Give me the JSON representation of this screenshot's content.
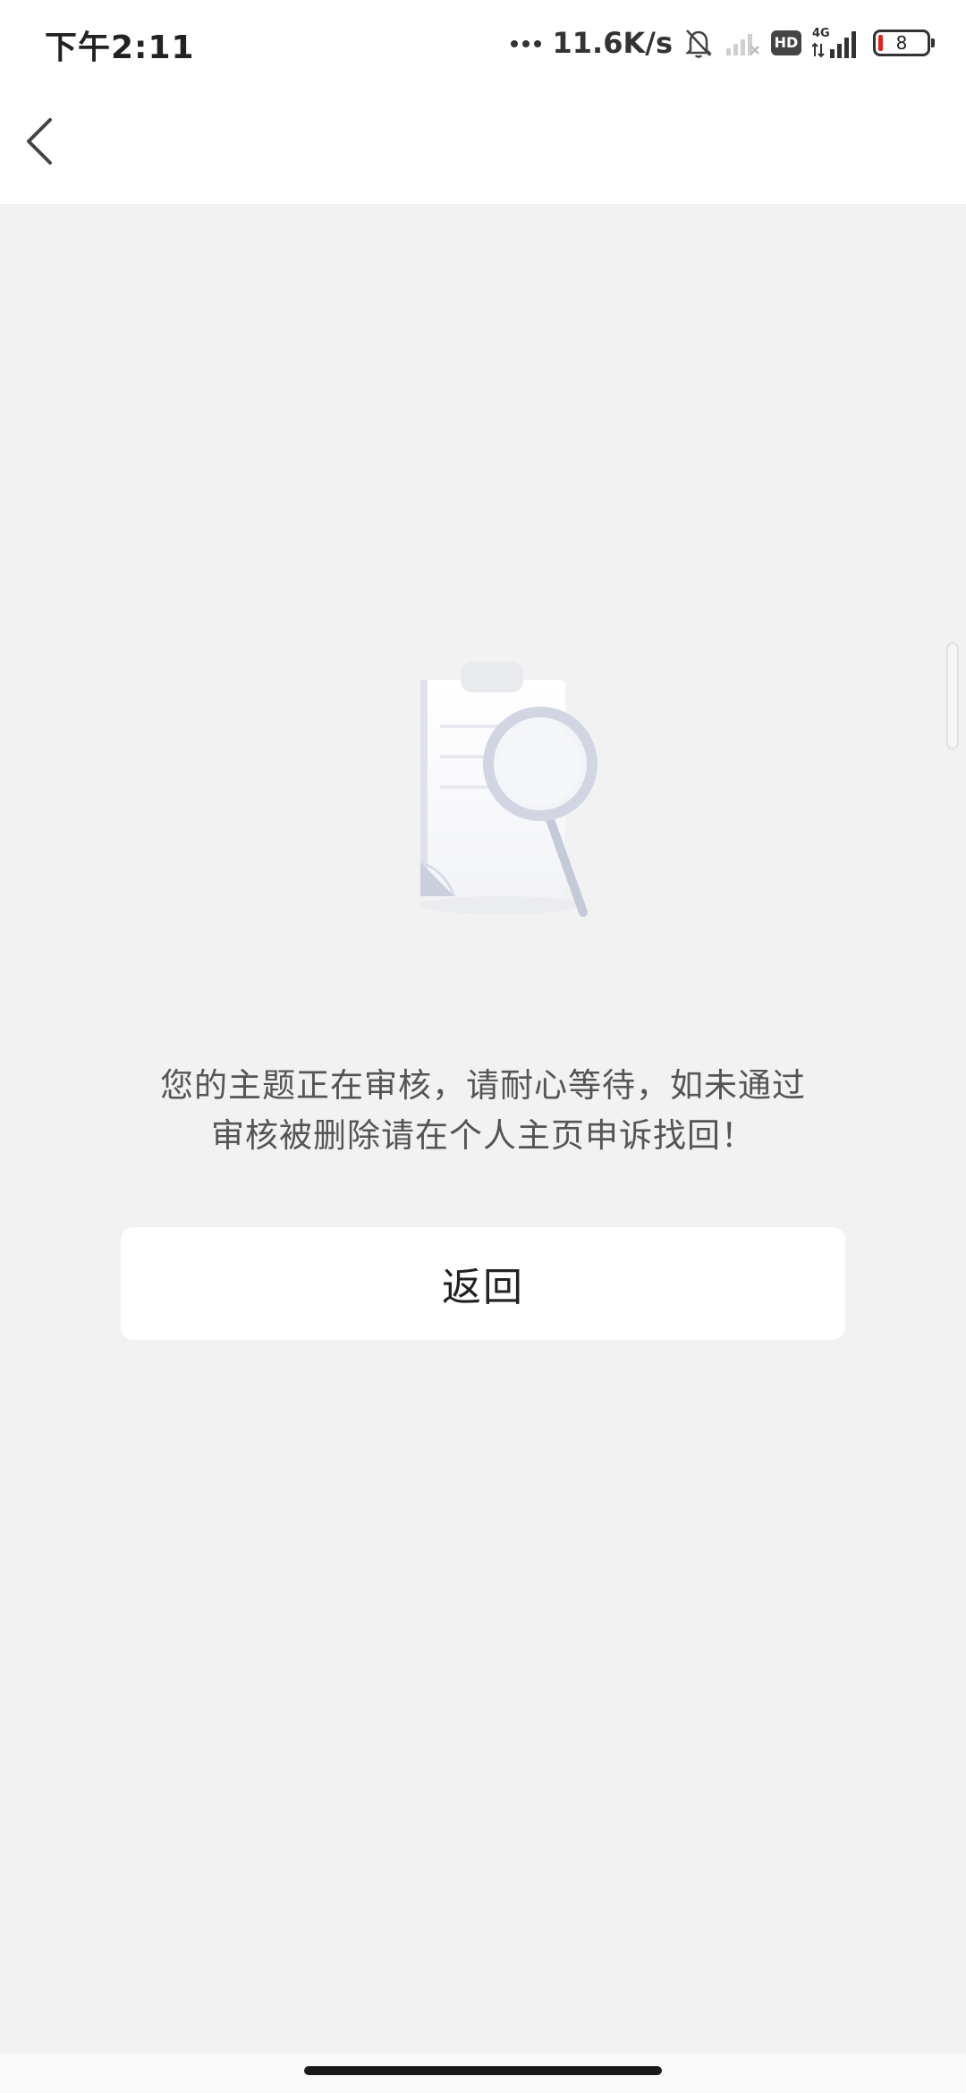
{
  "status_bar": {
    "time": "下午2:11",
    "net_speed": "11.6K/s",
    "hd_label": "HD",
    "network_type": "4G",
    "battery_level": "8",
    "icons": [
      "more-dots-icon",
      "bell-muted-icon",
      "signal-empty-icon",
      "hd-icon",
      "signal-4g-icon",
      "battery-icon"
    ]
  },
  "nav": {
    "back_icon": "chevron-left-icon"
  },
  "illustration": {
    "icon": "document-magnifier-icon"
  },
  "message": {
    "line1": "您的主题正在审核，请耐心等待，如未通过",
    "line2": "审核被删除请在个人主页申诉找回！"
  },
  "actions": {
    "return_label": "返回"
  },
  "colors": {
    "background": "#f2f2f3",
    "surface": "#ffffff",
    "text_primary": "#222222",
    "text_secondary": "#555555",
    "battery_low": "#e2231a"
  }
}
